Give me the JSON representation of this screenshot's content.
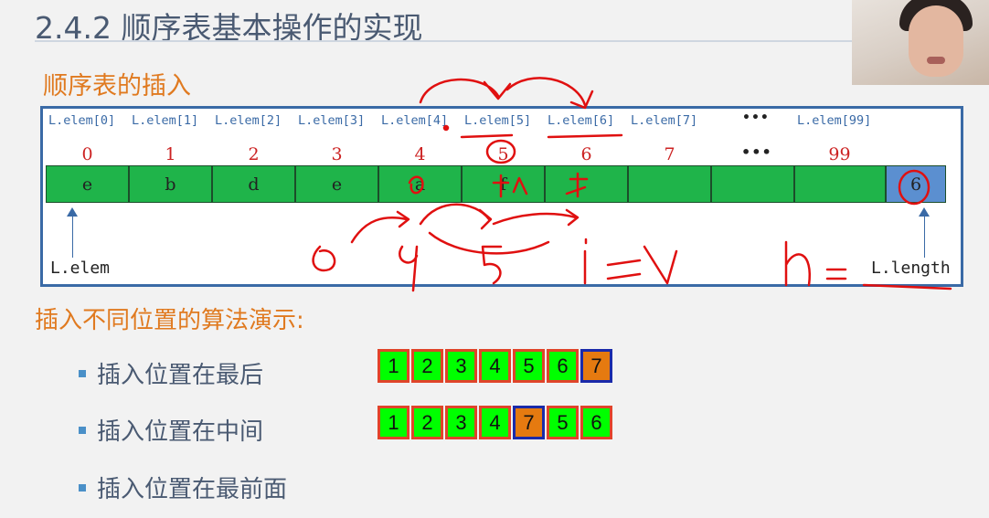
{
  "header": {
    "title": "2.4.2 顺序表基本操作的实现"
  },
  "subtitle": "顺序表的插入",
  "array": {
    "labels": [
      "L.elem[0]",
      "L.elem[1]",
      "L.elem[2]",
      "L.elem[3]",
      "L.elem[4]",
      "L.elem[5]",
      "L.elem[6]",
      "L.elem[7]",
      "L.elem[99]"
    ],
    "indices": [
      "0",
      "1",
      "2",
      "3",
      "4",
      "5",
      "6",
      "7",
      "99"
    ],
    "ellipsis": "•••",
    "cells": [
      "e",
      "b",
      "d",
      "e",
      "a",
      "f",
      "",
      "",
      "",
      ""
    ],
    "length_value": "6",
    "ptr_elem": "L.elem",
    "ptr_length": "L.length"
  },
  "demo": {
    "title": "插入不同位置的算法演示:",
    "items": [
      {
        "label": "插入位置在最后",
        "values": [
          "1",
          "2",
          "3",
          "4",
          "5",
          "6",
          "7"
        ],
        "highlight": 6
      },
      {
        "label": "插入位置在中间",
        "values": [
          "1",
          "2",
          "3",
          "4",
          "7",
          "5",
          "6"
        ],
        "highlight": 4
      },
      {
        "label": "插入位置在最前面",
        "values": [],
        "highlight": -1
      }
    ]
  },
  "annotations": {
    "ink_color": "#e01010"
  }
}
